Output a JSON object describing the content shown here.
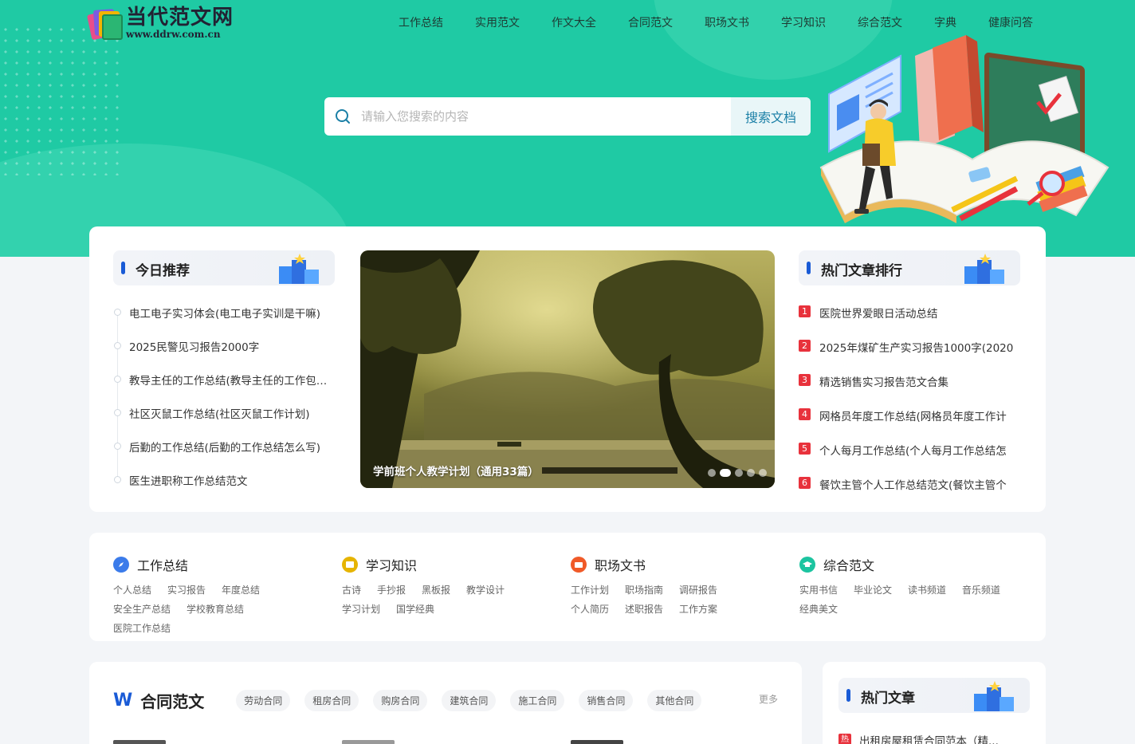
{
  "header": {
    "logo_title": "当代范文网",
    "logo_url": "www.ddrw.com.cn",
    "nav": [
      "工作总结",
      "实用范文",
      "作文大全",
      "合同范文",
      "职场文书",
      "学习知识",
      "综合范文",
      "字典",
      "健康问答"
    ]
  },
  "search": {
    "placeholder": "请输入您搜索的内容",
    "button_label": "搜索文档"
  },
  "recommend": {
    "title": "今日推荐",
    "items": [
      "电工电子实习体会(电工电子实训是干嘛)",
      "2025民警见习报告2000字",
      "教导主任的工作总结(教导主任的工作包括哪些)",
      "社区灭鼠工作总结(社区灭鼠工作计划)",
      "后勤的工作总结(后勤的工作总结怎么写)",
      "医生进职称工作总结范文"
    ]
  },
  "slider": {
    "caption": "学前班个人教学计划（通用33篇）",
    "dot_count": 5,
    "active_dot": 2
  },
  "hot_ranking": {
    "title": "热门文章排行",
    "items": [
      {
        "rank": "1",
        "text": "医院世界爱眼日活动总结"
      },
      {
        "rank": "2",
        "text": "2025年煤矿生产实习报告1000字(2020"
      },
      {
        "rank": "3",
        "text": "精选销售实习报告范文合集"
      },
      {
        "rank": "4",
        "text": "网格员年度工作总结(网格员年度工作计"
      },
      {
        "rank": "5",
        "text": "个人每月工作总结(个人每月工作总结怎"
      },
      {
        "rank": "6",
        "text": "餐饮主管个人工作总结范文(餐饮主管个"
      }
    ]
  },
  "categories": [
    {
      "title": "工作总结",
      "icon": "compass-icon",
      "color": "#3b7bea",
      "links": [
        "个人总结",
        "实习报告",
        "年度总结",
        "安全生产总结",
        "学校教育总结",
        "医院工作总结"
      ]
    },
    {
      "title": "学习知识",
      "icon": "book-icon",
      "color": "#e6b400",
      "links": [
        "古诗",
        "手抄报",
        "黑板报",
        "教学设计",
        "学习计划",
        "国学经典"
      ]
    },
    {
      "title": "职场文书",
      "icon": "briefcase-icon",
      "color": "#f05a28",
      "links": [
        "工作计划",
        "职场指南",
        "调研报告",
        "个人简历",
        "述职报告",
        "工作方案"
      ]
    },
    {
      "title": "综合范文",
      "icon": "graduation-cap-icon",
      "color": "#1cc4a0",
      "links": [
        "实用书信",
        "毕业论文",
        "读书频道",
        "音乐频道",
        "经典美文"
      ]
    }
  ],
  "contracts": {
    "icon_letter": "W",
    "title": "合同范文",
    "tags": [
      "劳动合同",
      "租房合同",
      "购房合同",
      "建筑合同",
      "施工合同",
      "销售合同",
      "其他合同"
    ],
    "more": "更多"
  },
  "hot_articles": {
    "title": "热门文章",
    "flag": "热",
    "first_item": "出租房屋租赁合同范本（精..."
  },
  "colors": {
    "brand_green": "#1fcaa4",
    "accent_blue": "#1a5bd6",
    "rank_red": "#e8323c"
  }
}
